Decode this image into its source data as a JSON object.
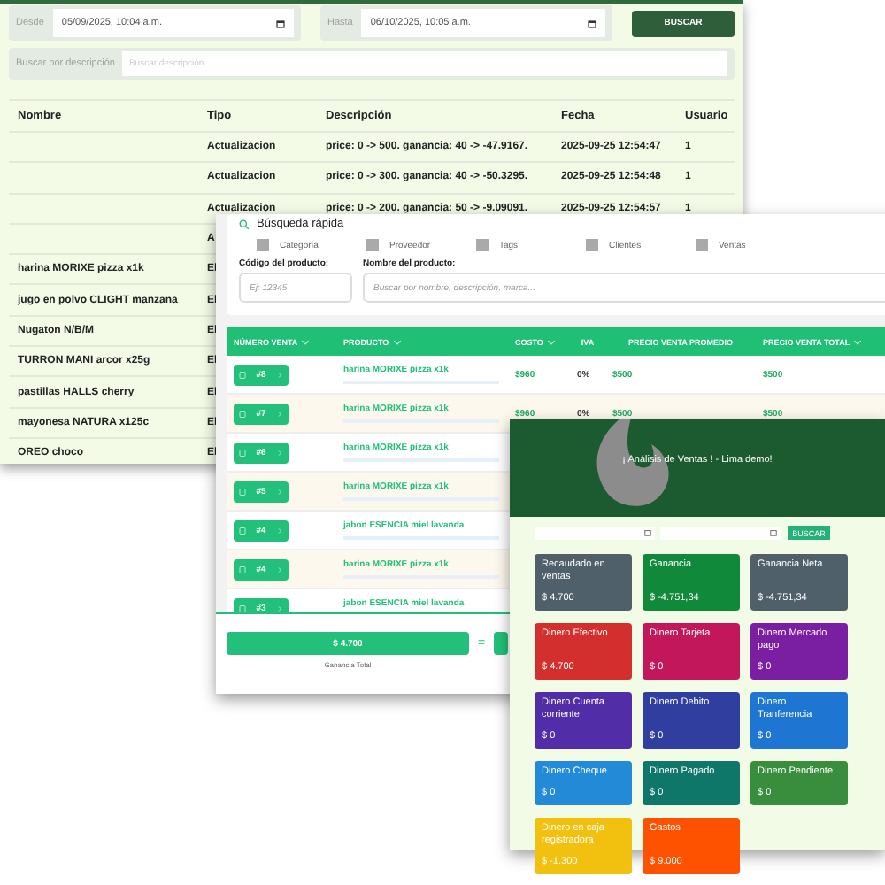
{
  "log_window": {
    "from_label": "Desde",
    "from_value": "05/09/2025, 10:04 a.m.",
    "to_label": "Hasta",
    "to_value": "06/10/2025, 10:05 a.m.",
    "search_button": "BUSCAR",
    "search_label": "Buscar por descripción",
    "search_placeholder": "Buscar descripción",
    "columns": [
      "Nombre",
      "Tipo",
      "Descripción",
      "Fecha",
      "Usuario"
    ],
    "rows": [
      {
        "tipo": "Actualizacion",
        "descripcion": "price: 0 -> 500. ganancia: 40 -> -47.9167.",
        "fecha": "2025-09-25 12:54:47",
        "usuario": "1"
      },
      {
        "tipo": "Actualizacion",
        "descripcion": "price: 0 -> 300. ganancia: 40 -> -50.3295.",
        "fecha": "2025-09-25 12:54:48",
        "usuario": "1"
      },
      {
        "tipo": "Actualizacion",
        "descripcion": "price: 0 -> 200. ganancia: 50 -> -9.09091.",
        "fecha": "2025-09-25 12:54:57",
        "usuario": "1"
      },
      {
        "tipo": "A"
      },
      {
        "nombre": "harina MORIXE pizza x1k",
        "tipo": "El"
      },
      {
        "nombre": "jugo en polvo CLIGHT manzana",
        "tipo": "El"
      },
      {
        "nombre": "Nugaton N/B/M",
        "tipo": "El"
      },
      {
        "nombre": "TURRON MANI arcor x25g",
        "tipo": "El"
      },
      {
        "nombre": "pastillas HALLS cherry",
        "tipo": "El"
      },
      {
        "nombre": "mayonesa NATURA x125c",
        "tipo": "El"
      },
      {
        "nombre": "OREO choco",
        "tipo": "El"
      }
    ]
  },
  "sales_window": {
    "quick_search": "Búsqueda rápida",
    "filters": [
      {
        "label": "Categoría",
        "checked": false
      },
      {
        "label": "Proveedor",
        "checked": false
      },
      {
        "label": "Tags",
        "checked": false
      },
      {
        "label": "Clientes",
        "checked": false
      },
      {
        "label": "Ventas",
        "checked": false
      }
    ],
    "code_label": "Código del producto:",
    "code_placeholder": "Ej: 12345",
    "name_label": "Nombre del producto:",
    "name_placeholder": "Buscar por nombre, descripción, marca...",
    "columns": [
      {
        "label": "NÚMERO VENTA",
        "sortable": true
      },
      {
        "label": "PRODUCTO",
        "sortable": true
      },
      {
        "label": "COSTO",
        "sortable": true
      },
      {
        "label": "IVA",
        "sortable": false
      },
      {
        "label": "PRECIO VENTA PROMEDIO",
        "sortable": false
      },
      {
        "label": "PRECIO VENTA TOTAL",
        "sortable": true
      }
    ],
    "rows": [
      {
        "number": "#8",
        "product": "harina MORIXE pizza x1k",
        "cost": "$960",
        "iva": "0%",
        "avg_price": "$500",
        "total_price": "$500"
      },
      {
        "number": "#7",
        "product": "harina MORIXE pizza x1k",
        "cost": "$960",
        "iva": "0%",
        "avg_price": "$500",
        "total_price": "$500"
      },
      {
        "number": "#6",
        "product": "harina MORIXE pizza x1k"
      },
      {
        "number": "#5",
        "product": "harina MORIXE pizza x1k"
      },
      {
        "number": "#4",
        "product": "jabon ESENCIA miel lavanda"
      },
      {
        "number": "#4",
        "product": "harina MORIXE pizza x1k"
      },
      {
        "number": "#3",
        "product": "jabon ESENCIA miel lavanda"
      }
    ],
    "total": "$ 4.700",
    "total_label": "Ganancia Total",
    "equals": "="
  },
  "analysis_window": {
    "title": "¡ Análisis de Ventas ! - Lima demo!",
    "search_button": "BUSCAR",
    "cards": [
      {
        "label": "Recaudado en ventas",
        "value": "$ 4.700",
        "color": "#4f606b"
      },
      {
        "label": "Ganancia",
        "value": "$ -4.751,34",
        "color": "#11893b"
      },
      {
        "label": "Ganancia Neta",
        "value": "$ -4.751,34",
        "color": "#4f606b"
      },
      {
        "label": "Dinero Efectivo",
        "value": "$ 4.700",
        "color": "#d42f2f"
      },
      {
        "label": "Dinero Tarjeta",
        "value": "$ 0",
        "color": "#c2185b"
      },
      {
        "label": "Dinero Mercado pago",
        "value": "$ 0",
        "color": "#7b1fa2"
      },
      {
        "label": "Dinero Cuenta corriente",
        "value": "$ 0",
        "color": "#512da8"
      },
      {
        "label": "Dinero Debito",
        "value": "$ 0",
        "color": "#303f9f"
      },
      {
        "label": "Dinero Tranferencia",
        "value": "$ 0",
        "color": "#1f76d2"
      },
      {
        "label": "Dinero Cheque",
        "value": "$ 0",
        "color": "#238ad8"
      },
      {
        "label": "Dinero Pagado",
        "value": "$ 0",
        "color": "#0f766a"
      },
      {
        "label": "Dinero Pendiente",
        "value": "$ 0",
        "color": "#388e3c"
      },
      {
        "label": "Dinero en caja registradora",
        "value": "$ -1.300",
        "color": "#f2c10f"
      },
      {
        "label": "Gastos",
        "value": "$ 9.000",
        "color": "#ff5200"
      }
    ]
  }
}
